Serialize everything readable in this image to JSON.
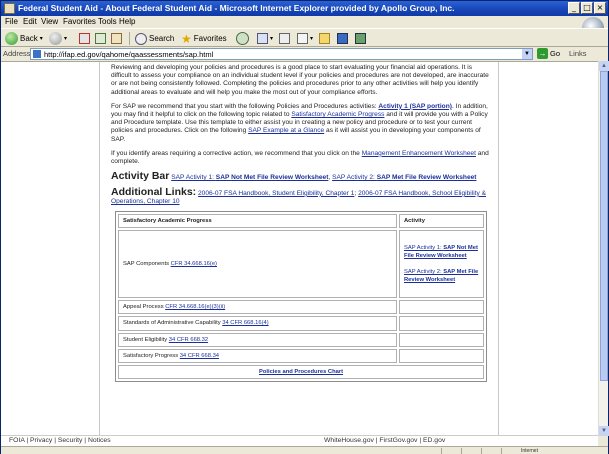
{
  "window": {
    "title": "Federal Student Aid - About Federal Student Aid - Microsoft Internet Explorer provided by Apollo Group, Inc.",
    "controls": [
      "_",
      "□",
      "×"
    ]
  },
  "menu": [
    "File",
    "Edit",
    "View",
    "Favorites",
    "Tools",
    "Help"
  ],
  "toolbar": {
    "back": "Back",
    "search": "Search",
    "favorites": "Favorites"
  },
  "address": {
    "label": "Address",
    "url": "http://ifap.ed.gov/qahome/qaassessments/sap.html",
    "go": "Go",
    "links": "Links"
  },
  "content": {
    "para1": "Reviewing and developing your policies and procedures is a good place to start evaluating your financial aid operations. It is difficult to assess your compliance on an individual student level if your policies and procedures are not developed, are inaccurate or are not being consistently followed. Completing the policies and procedures prior to any other activities will help you identify additional areas to evaluate and will help you make the most out of your compliance efforts.",
    "para2_a": "For SAP we recommend that you start with the following Policies and Procedures activities: ",
    "para2_link1": "Activity 1 (SAP portion)",
    "para2_b": ". In addition, you may find it helpful to click on the following topic related to ",
    "para2_link2": "Satisfactory Academic Progress",
    "para2_c": " and it will provide you with a Policy and Procedure template. Use this template to either assist you in creating a new policy and procedure or to test your current policies and procedures. Click on the following ",
    "para2_link3": "SAP Example at a Glance",
    "para2_d": " as it will assist you in developing your components of SAP.",
    "para3_a": "If you identify areas requiring a corrective action, we recommend that you click on the ",
    "para3_link": "Management Enhancement Worksheet",
    "para3_b": " and complete.",
    "activity_bar_title": "Activity Bar",
    "activity_link1_a": "SAP Activity 1: ",
    "activity_link1_b": "SAP Not Met File Review Worksheet",
    "activity_link2_a": "SAP Activity 2: ",
    "activity_link2_b": "SAP Met File Review Worksheet",
    "additional_title": "Additional Links:",
    "additional_link1": "2006-07 FSA Handbook, Student Eligibility, Chapter 1",
    "additional_link2": "2006-07 FSA Handbook, School Eligibility & Operations, Chapter 10"
  },
  "table": {
    "col1": "Satisfactory Academic Progress",
    "col2": "Activity",
    "rows": [
      {
        "label": "SAP Components ",
        "cfr": "CFR 34.668.16(e)"
      },
      {
        "label": "Appeal Process ",
        "cfr": "CFR 34.668.16(e)(3)(ii)"
      },
      {
        "label": "Standards of Administrative Capability ",
        "cfr": "34 CFR 668.16(4)"
      },
      {
        "label": "Student Eligibility ",
        "cfr": "34 CFR 668.32"
      },
      {
        "label": "Satisfactory Progress ",
        "cfr": "34 CFR 668.34"
      }
    ],
    "act1_a": "SAP Activity 1: ",
    "act1_b": "SAP Not Met File Review Worksheet",
    "act2_a": "SAP Activity 2: ",
    "act2_b": "SAP Met File Review Worksheet",
    "bottom_link": "Policies and Procedures Chart"
  },
  "footer": {
    "left": "FOIA  |  Privacy  |  Security  |  Notices",
    "right": "WhiteHouse.gov  |  FirstGov.gov  |  ED.gov"
  },
  "status": {
    "zone": "Internet"
  }
}
